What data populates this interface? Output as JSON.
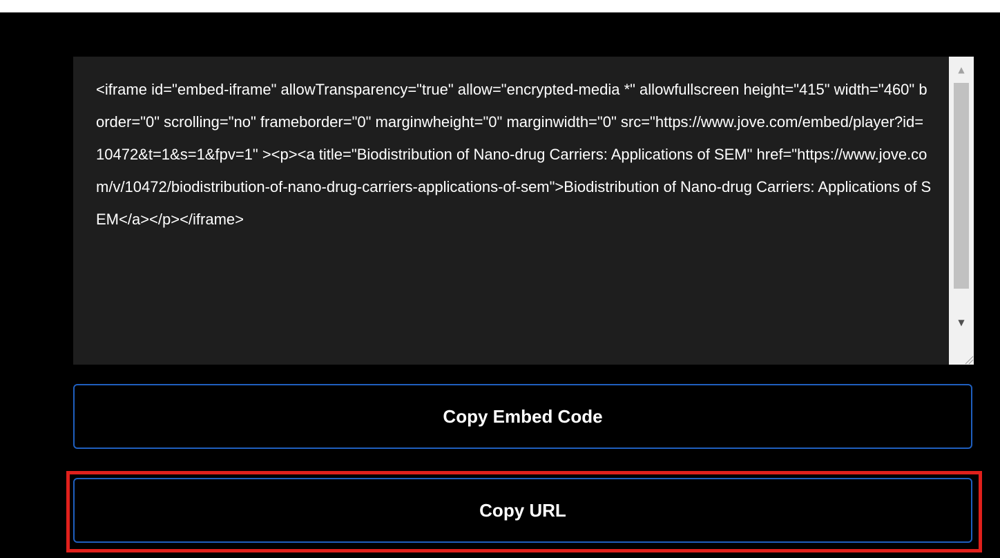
{
  "embed": {
    "code": "<iframe id=\"embed-iframe\" allowTransparency=\"true\" allow=\"encrypted-media *\" allowfullscreen height=\"415\" width=\"460\" border=\"0\" scrolling=\"no\" frameborder=\"0\" marginwheight=\"0\" marginwidth=\"0\" src=\"https://www.jove.com/embed/player?id=10472&t=1&s=1&fpv=1\" ><p><a title=\"Biodistribution of Nano-drug Carriers: Applications of SEM\" href=\"https://www.jove.com/v/10472/biodistribution-of-nano-drug-carriers-applications-of-sem\">Biodistribution of Nano-drug Carriers: Applications of SEM</a></p></iframe>",
    "scroll_up_icon": "▲",
    "scroll_down_icon": "▼"
  },
  "buttons": {
    "copy_embed_label": "Copy Embed Code",
    "copy_url_label": "Copy URL"
  },
  "colors": {
    "button_border": "#1f5fbf",
    "highlight": "#e0201c",
    "code_background": "#1e1e1e"
  }
}
